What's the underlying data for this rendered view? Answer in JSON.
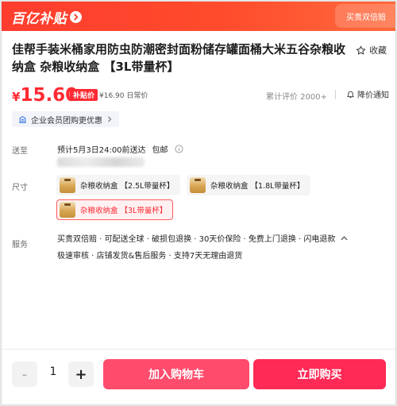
{
  "banner": {
    "logo_text": "百亿补贴",
    "right_tag": "买贵双倍赔"
  },
  "product": {
    "title": "佳帮手装米桶家用防虫防潮密封面粉储存罐面桶大米五谷杂粮收纳盒 杂粮收纳盒 【3L带量杯】",
    "favorite_label": "收藏"
  },
  "price": {
    "currency": "¥",
    "value": "15.60",
    "subsidy_badge": "补贴价",
    "daily_price": "¥16.90 日常价",
    "reviews": "累计评价 2000+",
    "notify_label": "降价通知"
  },
  "vip": {
    "label": "企业会员团购更优惠"
  },
  "shipping": {
    "label": "送至",
    "delivery": "预计5月3日24:00前送达",
    "free_shipping": "包邮"
  },
  "size": {
    "label": "尺寸",
    "options": [
      {
        "label": "杂粮收纳盒 【2.5L带量杯】",
        "selected": false
      },
      {
        "label": "杂粮收纳盒 【1.8L带量杯】",
        "selected": false
      },
      {
        "label": "杂粮收纳盒 【3L带量杯】",
        "selected": true
      }
    ]
  },
  "service": {
    "label": "服务",
    "line1": "买贵双倍赔 · 可配送全球 · 破损包退换 · 30天价保险 · 免费上门退换 · 闪电退款",
    "line2": "极速审核 · 店铺发货&售后服务 · 支持7天无理由退货"
  },
  "purchase": {
    "minus": "-",
    "quantity": "1",
    "plus": "+",
    "add_to_cart": "加入购物车",
    "buy_now": "立即购买"
  },
  "colors": {
    "accent_red": "#ff2a33",
    "cart_button": "#ff4b6c",
    "buy_button": "#ff2a55"
  }
}
